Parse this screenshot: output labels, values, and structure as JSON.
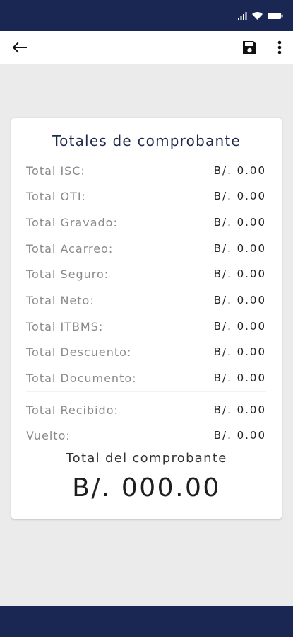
{
  "app_bar": {
    "back_icon": "arrow-left-icon",
    "save_icon": "floppy-disk-icon",
    "more_icon": "more-vertical-icon"
  },
  "status_bar": {
    "icons": [
      "signal-icon",
      "wifi-icon",
      "battery-icon"
    ]
  },
  "card": {
    "title": "Totales de comprobante",
    "rows": [
      {
        "label": "Total ISC:",
        "value": "B/. 0.00"
      },
      {
        "label": "Total OTI:",
        "value": "B/. 0.00"
      },
      {
        "label": "Total Gravado:",
        "value": "B/. 0.00"
      },
      {
        "label": "Total Acarreo:",
        "value": "B/. 0.00"
      },
      {
        "label": "Total Seguro:",
        "value": "B/. 0.00"
      },
      {
        "label": "Total Neto:",
        "value": "B/. 0.00"
      },
      {
        "label": "Total ITBMS:",
        "value": "B/. 0.00"
      },
      {
        "label": "Total Descuento:",
        "value": "B/. 0.00"
      },
      {
        "label": "Total Documento:",
        "value": "B/. 0.00"
      },
      {
        "label": "Total Recibido:",
        "value": "B/. 0.00"
      },
      {
        "label": "Vuelto:",
        "value": "B/. 0.00"
      }
    ],
    "total_label": "Total del comprobante",
    "total_value": "B/. 000.00"
  },
  "colors": {
    "primary": "#1a2753",
    "background": "#ebebeb",
    "card": "#ffffff"
  }
}
